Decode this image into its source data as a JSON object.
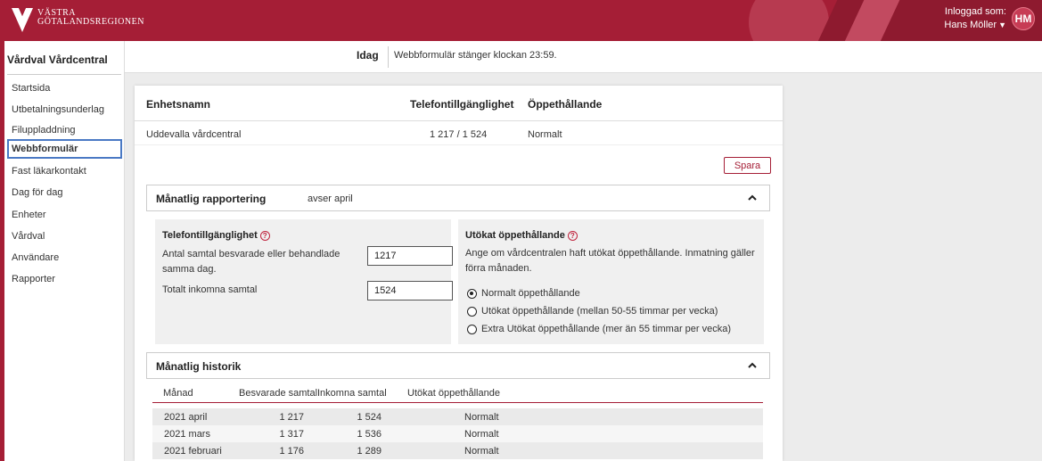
{
  "header": {
    "logo_line1": "VÄSTRA",
    "logo_line2": "GÖTALANDSREGIONEN",
    "logged_in_label": "Inloggad som:",
    "user_name": "Hans Möller",
    "avatar_initials": "HM"
  },
  "sidebar": {
    "title": "Vårdval Vårdcentral",
    "items": [
      {
        "label": "Startsida",
        "active": false
      },
      {
        "label": "Utbetalningsunderlag",
        "active": false
      },
      {
        "label": "Filuppladdning",
        "active": false
      },
      {
        "label": "Webbformulär",
        "active": true
      },
      {
        "label": "Fast läkarkontakt",
        "active": false
      },
      {
        "label": "Dag för dag",
        "active": false
      },
      {
        "label": "Enheter",
        "active": false
      },
      {
        "label": "Vårdval",
        "active": false
      },
      {
        "label": "Användare",
        "active": false
      },
      {
        "label": "Rapporter",
        "active": false
      }
    ]
  },
  "notice": {
    "tag": "Idag",
    "message": "Webbformulär stänger klockan 23:59."
  },
  "unit_table": {
    "headers": [
      "Enhetsnamn",
      "Telefontillgänglighet",
      "Öppethållande"
    ],
    "row": {
      "name": "Uddevalla vårdcentral",
      "phone": "1 217 / 1 524",
      "opening": "Normalt"
    }
  },
  "save_label": "Spara",
  "monthly_report": {
    "title": "Månatlig rapportering",
    "subtitle": "avser april",
    "phone": {
      "title": "Telefontillgänglighet",
      "answered_label": "Antal samtal besvarade eller behandlade samma dag.",
      "answered_value": "1217",
      "total_label": "Totalt inkomna samtal",
      "total_value": "1524"
    },
    "opening": {
      "title": "Utökat öppethållande",
      "description": "Ange om vårdcentralen haft utökat öppethållande. Inmatning gäller förra månaden.",
      "options": [
        {
          "label": "Normalt öppethållande",
          "selected": true
        },
        {
          "label": "Utökat öppethållande (mellan 50-55 timmar per vecka)",
          "selected": false
        },
        {
          "label": "Extra Utökat öppethållande (mer än 55 timmar per vecka)",
          "selected": false
        }
      ]
    }
  },
  "history": {
    "title": "Månatlig historik",
    "columns": [
      "Månad",
      "Besvarade samtal",
      "Inkomna samtal",
      "Utökat öppethållande"
    ],
    "rows": [
      {
        "month": "2021 april",
        "answered": "1 217",
        "incoming": "1 524",
        "extended": "Normalt"
      },
      {
        "month": "2021 mars",
        "answered": "1 317",
        "incoming": "1 536",
        "extended": "Normalt"
      },
      {
        "month": "2021 februari",
        "answered": "1 176",
        "incoming": "1 289",
        "extended": "Normalt"
      }
    ]
  },
  "colors": {
    "brand": "#a51e36",
    "active_outline": "#4a79c4"
  },
  "icons": {
    "collapse": "chevron-up-icon",
    "help": "help-circle-icon",
    "user_menu": "chevron-down-icon"
  }
}
